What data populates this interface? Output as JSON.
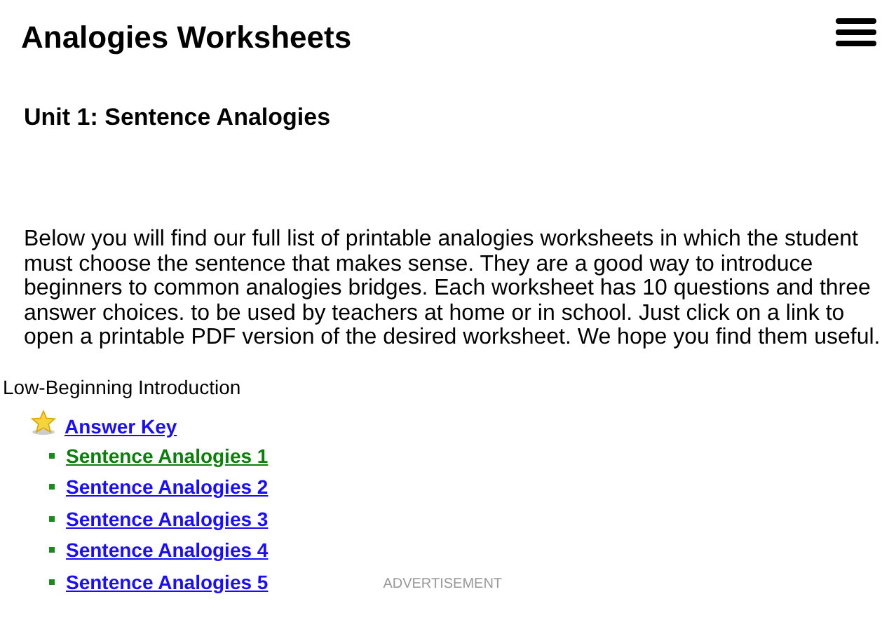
{
  "header": {
    "title": "Analogies Worksheets"
  },
  "unit_title": "Unit 1: Sentence Analogies",
  "intro": "Below you will find our full list of printable analogies worksheets in which the student must choose the sentence that makes sense. They are a good way to introduce beginners to common analogies bridges. Each worksheet has 10 questions and three answer choices. to be used by teachers at home or in school. Just click on a link to open a printable PDF version of the desired worksheet. We hope you find them useful.",
  "section": {
    "title": "Low-Beginning Introduction",
    "answer_key": "Answer Key",
    "links": [
      {
        "label": "Sentence Analogies 1",
        "visited": true
      },
      {
        "label": "Sentence Analogies 2",
        "visited": false
      },
      {
        "label": "Sentence Analogies 3",
        "visited": false
      },
      {
        "label": "Sentence Analogies 4",
        "visited": false
      },
      {
        "label": "Sentence Analogies 5",
        "visited": false
      }
    ]
  },
  "advertisement": "ADVERTISEMENT"
}
